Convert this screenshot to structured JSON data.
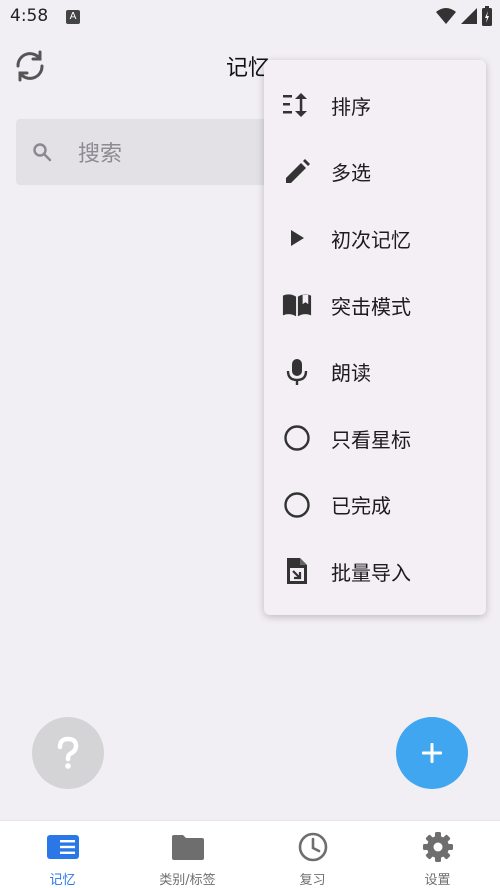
{
  "status_bar": {
    "time": "4:58",
    "notif_letter": "A"
  },
  "header": {
    "title": "记忆"
  },
  "search": {
    "placeholder": "搜索"
  },
  "menu": {
    "items": [
      {
        "label": "排序",
        "icon": "sort-icon"
      },
      {
        "label": "多选",
        "icon": "pencil-icon"
      },
      {
        "label": "初次记忆",
        "icon": "play-icon"
      },
      {
        "label": "突击模式",
        "icon": "book-icon"
      },
      {
        "label": "朗读",
        "icon": "microphone-icon"
      },
      {
        "label": "只看星标",
        "icon": "radio-empty-icon"
      },
      {
        "label": "已完成",
        "icon": "radio-empty-icon"
      },
      {
        "label": "批量导入",
        "icon": "file-import-icon"
      }
    ]
  },
  "fab": {
    "help_symbol": "?",
    "add_symbol": "+"
  },
  "bottom_nav": {
    "items": [
      {
        "label": "记忆",
        "icon": "card-list-icon",
        "active": true
      },
      {
        "label": "类别/标签",
        "icon": "folder-icon",
        "active": false
      },
      {
        "label": "复习",
        "icon": "clock-icon",
        "active": false
      },
      {
        "label": "设置",
        "icon": "gear-icon",
        "active": false
      }
    ]
  },
  "colors": {
    "accent": "#2a78e8",
    "fab": "#3fa6ef",
    "background": "#f2eff4"
  }
}
